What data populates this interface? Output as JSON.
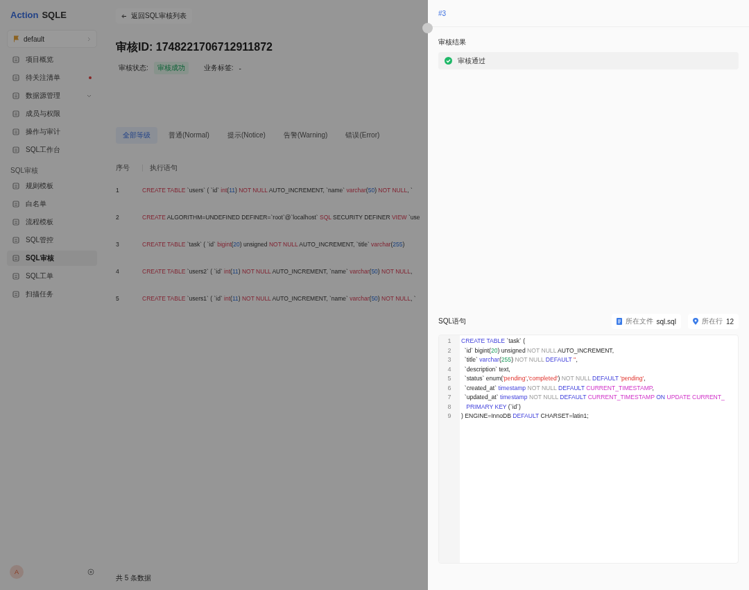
{
  "brand": {
    "first": "Action",
    "second": "SQLE"
  },
  "project": {
    "name": "default"
  },
  "sidebar": {
    "items": [
      {
        "label": "项目概览",
        "selected": false,
        "alert": false,
        "expandable": false
      },
      {
        "label": "待关注清单",
        "selected": false,
        "alert": true,
        "expandable": false
      },
      {
        "label": "数据源管理",
        "selected": false,
        "alert": false,
        "expandable": true
      },
      {
        "label": "成员与权限",
        "selected": false,
        "alert": false,
        "expandable": false
      },
      {
        "label": "操作与审计",
        "selected": false,
        "alert": false,
        "expandable": false
      },
      {
        "label": "SQL工作台",
        "selected": false,
        "alert": false,
        "expandable": false
      }
    ],
    "group": "SQL审核",
    "group_items": [
      {
        "label": "规则模板",
        "selected": false,
        "alert": false,
        "expandable": false
      },
      {
        "label": "白名单",
        "selected": false,
        "alert": false,
        "expandable": false
      },
      {
        "label": "流程模板",
        "selected": false,
        "alert": false,
        "expandable": false
      },
      {
        "label": "SQL管控",
        "selected": false,
        "alert": false,
        "expandable": false
      },
      {
        "label": "SQL审核",
        "selected": true,
        "alert": false,
        "expandable": false
      },
      {
        "label": "SQL工单",
        "selected": false,
        "alert": false,
        "expandable": false
      },
      {
        "label": "扫描任务",
        "selected": false,
        "alert": false,
        "expandable": false
      }
    ],
    "avatar": "A"
  },
  "back_link": "返回SQL审核列表",
  "title": "审核ID: 1748221706712911872",
  "status": {
    "label": "审核状态:",
    "value": "审核成功"
  },
  "tag": {
    "label": "业务标签:",
    "value": "-"
  },
  "tabs": [
    {
      "label": "全部等级",
      "selected": true
    },
    {
      "label": "普通(Normal)",
      "selected": false
    },
    {
      "label": "提示(Notice)",
      "selected": false
    },
    {
      "label": "告警(Warning)",
      "selected": false
    },
    {
      "label": "错误(Error)",
      "selected": false
    }
  ],
  "table": {
    "columns": [
      "序号",
      "执行语句"
    ],
    "rows": [
      {
        "index": "1",
        "sql": [
          {
            "kind": "kw",
            "text": "CREATE TABLE"
          },
          {
            "kind": "plain",
            "text": " `users` ( `id` "
          },
          {
            "kind": "kw",
            "text": "int"
          },
          {
            "kind": "plain",
            "text": "("
          },
          {
            "kind": "num",
            "text": "11"
          },
          {
            "kind": "plain",
            "text": ") "
          },
          {
            "kind": "kw",
            "text": "NOT NULL"
          },
          {
            "kind": "plain",
            "text": " AUTO_INCREMENT, `name` "
          },
          {
            "kind": "kw",
            "text": "varchar"
          },
          {
            "kind": "plain",
            "text": "("
          },
          {
            "kind": "num",
            "text": "50"
          },
          {
            "kind": "plain",
            "text": ") "
          },
          {
            "kind": "kw",
            "text": "NOT NULL"
          },
          {
            "kind": "plain",
            "text": ", `"
          }
        ]
      },
      {
        "index": "2",
        "sql": [
          {
            "kind": "kw",
            "text": "CREATE"
          },
          {
            "kind": "plain",
            "text": " ALGORITHM=UNDEFINED DEFINER=`root`@`localhost` "
          },
          {
            "kind": "kw",
            "text": "SQL"
          },
          {
            "kind": "plain",
            "text": " SECURITY DEFINER "
          },
          {
            "kind": "kw",
            "text": "VIEW"
          },
          {
            "kind": "plain",
            "text": " `use"
          }
        ]
      },
      {
        "index": "3",
        "sql": [
          {
            "kind": "kw",
            "text": "CREATE TABLE"
          },
          {
            "kind": "plain",
            "text": " `task` ( `id` "
          },
          {
            "kind": "kw",
            "text": "bigint"
          },
          {
            "kind": "plain",
            "text": "("
          },
          {
            "kind": "num",
            "text": "20"
          },
          {
            "kind": "plain",
            "text": ") unsigned "
          },
          {
            "kind": "kw",
            "text": "NOT NULL"
          },
          {
            "kind": "plain",
            "text": " AUTO_INCREMENT, `title` "
          },
          {
            "kind": "kw",
            "text": "varchar"
          },
          {
            "kind": "plain",
            "text": "("
          },
          {
            "kind": "num",
            "text": "255"
          },
          {
            "kind": "plain",
            "text": ")"
          }
        ]
      },
      {
        "index": "4",
        "sql": [
          {
            "kind": "kw",
            "text": "CREATE TABLE"
          },
          {
            "kind": "plain",
            "text": " `users2` ( `id` "
          },
          {
            "kind": "kw",
            "text": "int"
          },
          {
            "kind": "plain",
            "text": "("
          },
          {
            "kind": "num",
            "text": "11"
          },
          {
            "kind": "plain",
            "text": ") "
          },
          {
            "kind": "kw",
            "text": "NOT NULL"
          },
          {
            "kind": "plain",
            "text": " AUTO_INCREMENT, `name` "
          },
          {
            "kind": "kw",
            "text": "varchar"
          },
          {
            "kind": "plain",
            "text": "("
          },
          {
            "kind": "num",
            "text": "50"
          },
          {
            "kind": "plain",
            "text": ") "
          },
          {
            "kind": "kw",
            "text": "NOT NULL"
          },
          {
            "kind": "plain",
            "text": ","
          }
        ]
      },
      {
        "index": "5",
        "sql": [
          {
            "kind": "kw",
            "text": "CREATE TABLE"
          },
          {
            "kind": "plain",
            "text": " `users1` ( `id` "
          },
          {
            "kind": "kw",
            "text": "int"
          },
          {
            "kind": "plain",
            "text": "("
          },
          {
            "kind": "num",
            "text": "11"
          },
          {
            "kind": "plain",
            "text": ") "
          },
          {
            "kind": "kw",
            "text": "NOT NULL"
          },
          {
            "kind": "plain",
            "text": " AUTO_INCREMENT, `name` "
          },
          {
            "kind": "kw",
            "text": "varchar"
          },
          {
            "kind": "plain",
            "text": "("
          },
          {
            "kind": "num",
            "text": "50"
          },
          {
            "kind": "plain",
            "text": ") "
          },
          {
            "kind": "kw",
            "text": "NOT NULL"
          },
          {
            "kind": "plain",
            "text": ", `"
          }
        ]
      }
    ],
    "total": "共 5 条数据"
  },
  "drawer": {
    "title": "#3",
    "result_heading": "审核结果",
    "result": "审核通过",
    "sql_heading": "SQL语句",
    "file": {
      "label": "所在文件",
      "value": "sql.sql"
    },
    "line": {
      "label": "所在行",
      "value": "12"
    },
    "line_numbers": [
      "1",
      "2",
      "3",
      "4",
      "5",
      "6",
      "7",
      "8",
      "9"
    ],
    "code": [
      [
        {
          "kind": "kw",
          "text": "CREATE TABLE"
        },
        {
          "kind": "plain",
          "text": " `task` ("
        }
      ],
      [
        {
          "kind": "plain",
          "text": "  `id` bigint("
        },
        {
          "kind": "num",
          "text": "20"
        },
        {
          "kind": "plain",
          "text": ") unsigned "
        },
        {
          "kind": "muted",
          "text": "NOT NULL"
        },
        {
          "kind": "plain",
          "text": " AUTO_INCREMENT,"
        }
      ],
      [
        {
          "kind": "plain",
          "text": "  `title` "
        },
        {
          "kind": "kw",
          "text": "varchar"
        },
        {
          "kind": "plain",
          "text": "("
        },
        {
          "kind": "num",
          "text": "255"
        },
        {
          "kind": "plain",
          "text": ") "
        },
        {
          "kind": "muted",
          "text": "NOT NULL "
        },
        {
          "kind": "kw",
          "text": "DEFAULT "
        },
        {
          "kind": "str",
          "text": "''"
        },
        {
          "kind": "plain",
          "text": ","
        }
      ],
      [
        {
          "kind": "plain",
          "text": "  `description` text,"
        }
      ],
      [
        {
          "kind": "plain",
          "text": "  `status` enum("
        },
        {
          "kind": "str",
          "text": "'pending'"
        },
        {
          "kind": "plain",
          "text": ","
        },
        {
          "kind": "str",
          "text": "'completed'"
        },
        {
          "kind": "plain",
          "text": ") "
        },
        {
          "kind": "muted",
          "text": "NOT NULL "
        },
        {
          "kind": "kw",
          "text": "DEFAULT "
        },
        {
          "kind": "str",
          "text": "'pending'"
        },
        {
          "kind": "plain",
          "text": ","
        }
      ],
      [
        {
          "kind": "plain",
          "text": "  `created_at` "
        },
        {
          "kind": "kw",
          "text": "timestamp "
        },
        {
          "kind": "muted",
          "text": "NOT NULL "
        },
        {
          "kind": "kw",
          "text": "DEFAULT "
        },
        {
          "kind": "const",
          "text": "CURRENT_TIMESTAMP"
        },
        {
          "kind": "plain",
          "text": ","
        }
      ],
      [
        {
          "kind": "plain",
          "text": "  `updated_at` "
        },
        {
          "kind": "kw",
          "text": "timestamp "
        },
        {
          "kind": "muted",
          "text": "NOT NULL "
        },
        {
          "kind": "kw",
          "text": "DEFAULT "
        },
        {
          "kind": "const",
          "text": "CURRENT_TIMESTAMP "
        },
        {
          "kind": "kw",
          "text": "ON "
        },
        {
          "kind": "const",
          "text": "UPDATE CURRENT_"
        }
      ],
      [
        {
          "kind": "kw",
          "text": "   PRIMARY KEY"
        },
        {
          "kind": "plain",
          "text": " (`id`)"
        }
      ],
      [
        {
          "kind": "plain",
          "text": ") ENGINE=InnoDB "
        },
        {
          "kind": "kw",
          "text": "DEFAULT"
        },
        {
          "kind": "plain",
          "text": " CHARSET=latin1;"
        }
      ]
    ]
  }
}
